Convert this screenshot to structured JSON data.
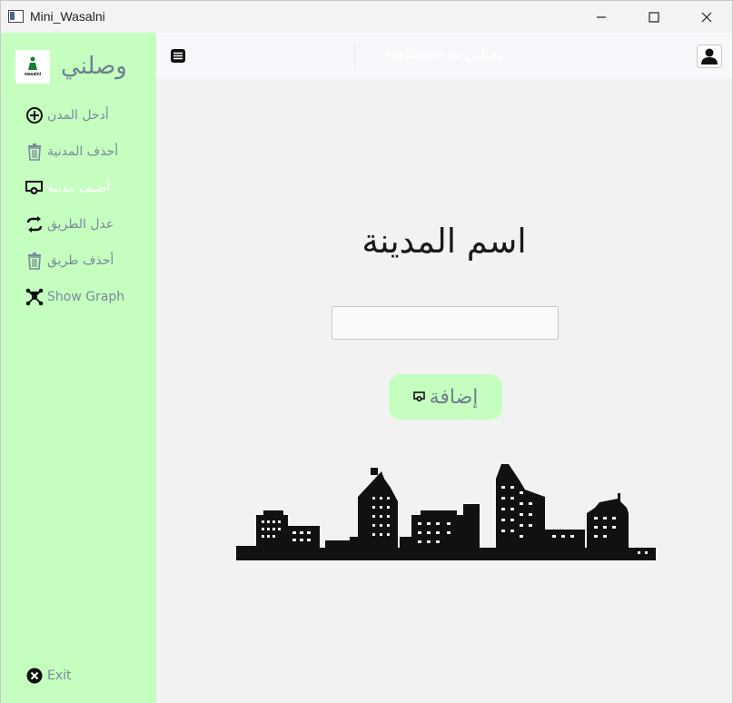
{
  "window": {
    "title": "Mini_Wasalni"
  },
  "sidebar": {
    "logo_text": "wasalni",
    "brand": "وصلني",
    "items": [
      {
        "label": "أدخل المدن",
        "icon": "plus-circle-icon"
      },
      {
        "label": "أحذف المدنية",
        "icon": "trash-icon"
      },
      {
        "label": "أضيف مدنية",
        "icon": "add-location-icon"
      },
      {
        "label": "عدل الطريق",
        "icon": "swap-arrows-icon"
      },
      {
        "label": "أحذف طريق",
        "icon": "trash-icon"
      },
      {
        "label": "Show Graph",
        "icon": "graph-nodes-icon"
      }
    ],
    "exit_label": "Exit"
  },
  "header": {
    "welcome": "Welcome to وصلني"
  },
  "main": {
    "title": "اسم المدينة",
    "city_input_value": "",
    "add_button_label": "إضافة"
  },
  "colors": {
    "sidebar_bg": "#c4ffc0",
    "active_label": "#ffffff",
    "label": "#7b8a99"
  }
}
